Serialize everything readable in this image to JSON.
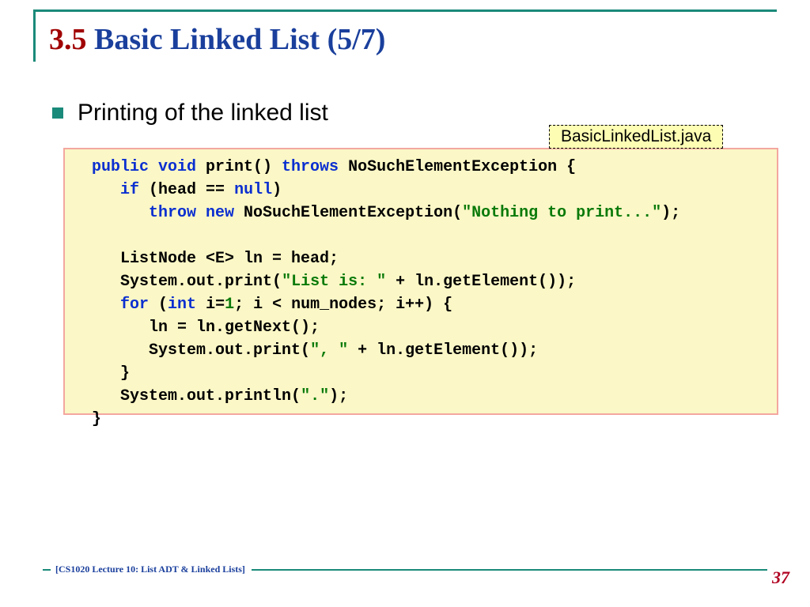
{
  "title": {
    "section_number": "3.5",
    "text": "Basic Linked List (5/7)"
  },
  "bullet": {
    "text": "Printing of the linked list"
  },
  "file_tab": "BasicLinkedList.java",
  "code": {
    "l1": {
      "a": "public void ",
      "b": "print() ",
      "c": "throws ",
      "d": "NoSuchElementException {"
    },
    "l2": {
      "a": "if ",
      "b": "(head == ",
      "c": "null",
      "d": ")"
    },
    "l3": {
      "a": "throw new ",
      "b": "NoSuchElementException(",
      "c": "\"Nothing to print...\"",
      "d": ");"
    },
    "l4": "ListNode <E> ln = head;",
    "l5": {
      "a": "System.out.print(",
      "b": "\"List is: \" ",
      "c": "+ ln.getElement());"
    },
    "l6": {
      "a": "for ",
      "b": "(",
      "c": "int ",
      "d": "i=",
      "e": "1",
      "f": "; i < num_nodes; i++) {"
    },
    "l7": "ln = ln.getNext();",
    "l8": {
      "a": "System.out.print(",
      "b": "\", \" ",
      "c": "+ ln.getElement());"
    },
    "l9": "}",
    "l10": {
      "a": "System.out.println(",
      "b": "\".\"",
      "c": ");"
    },
    "l11": "}"
  },
  "footer": {
    "text": "[CS1020 Lecture 10: List ADT & Linked Lists]",
    "page": "37"
  }
}
